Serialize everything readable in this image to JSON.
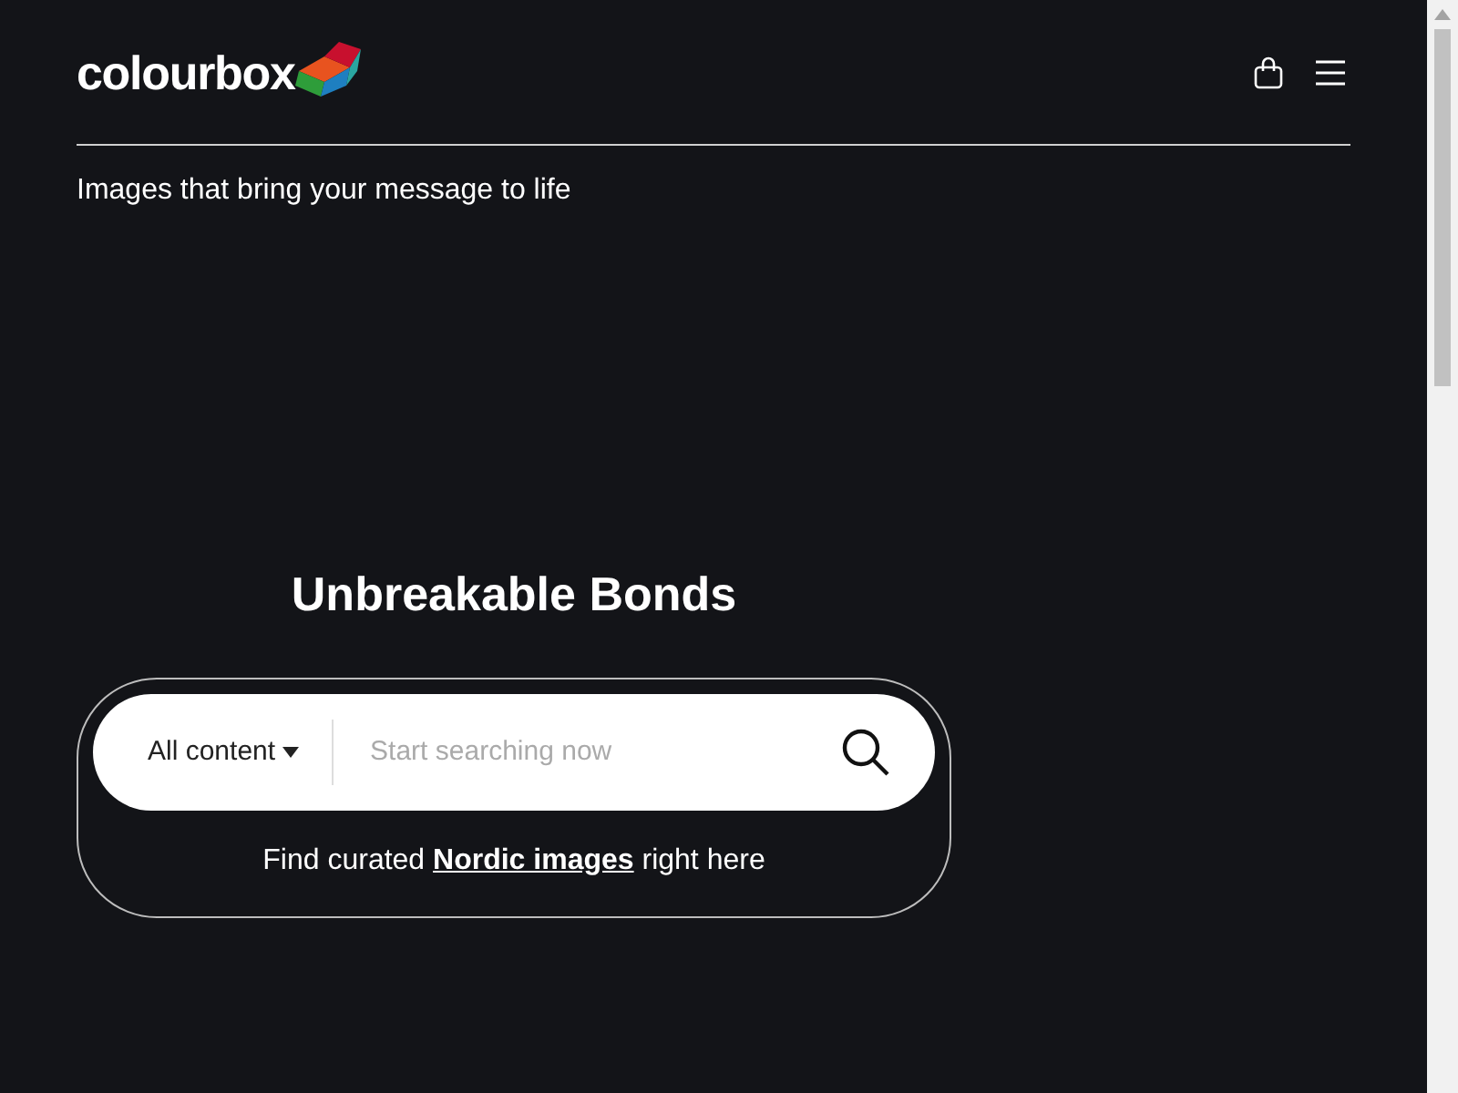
{
  "header": {
    "logo": "colourbox",
    "tagline": "Images that bring your message to life"
  },
  "hero": {
    "title": "Unbreakable Bonds",
    "search": {
      "category": "All content",
      "placeholder": "Start searching now"
    },
    "note": {
      "before": "Find curated",
      "link": "Nordic images",
      "after": "right here"
    }
  }
}
